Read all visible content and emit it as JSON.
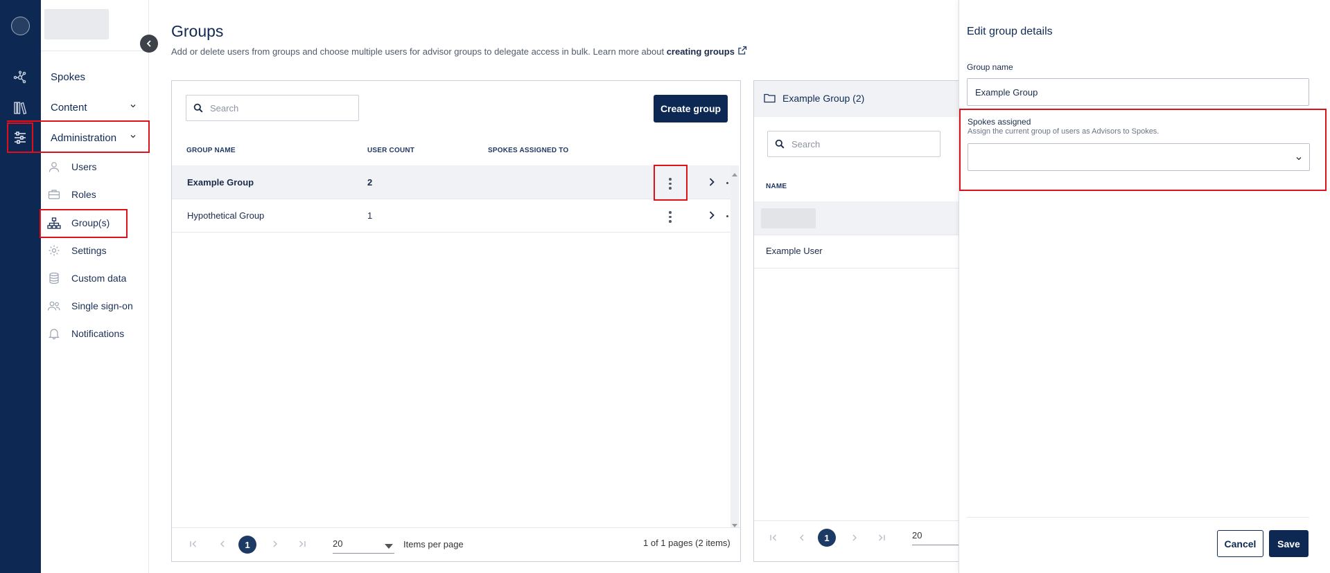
{
  "nav": {
    "spokes": "Spokes",
    "content": "Content",
    "administration": "Administration",
    "sub_items": [
      {
        "label": "Users"
      },
      {
        "label": "Roles"
      },
      {
        "label": "Group(s)"
      },
      {
        "label": "Settings"
      },
      {
        "label": "Custom data"
      },
      {
        "label": "Single sign-on"
      },
      {
        "label": "Notifications"
      }
    ]
  },
  "page": {
    "title": "Groups",
    "description": "Add or delete users from groups and choose multiple users for advisor groups to delegate access in bulk. Learn more about ",
    "link_text": "creating groups"
  },
  "groups_panel": {
    "search_placeholder": "Search",
    "create_button": "Create group",
    "columns": [
      "GROUP NAME",
      "USER COUNT",
      "SPOKES ASSIGNED TO"
    ],
    "rows": [
      {
        "name": "Example Group",
        "count": "2",
        "spokes": ""
      },
      {
        "name": "Hypothetical Group",
        "count": "1",
        "spokes": ""
      }
    ],
    "pager": {
      "current_page": "1",
      "items_per_page": "20",
      "items_per_page_label": "Items per page",
      "summary": "1 of 1 pages (2 items)"
    }
  },
  "members_panel": {
    "title": "Example Group (2)",
    "search_placeholder": "Search",
    "column": "NAME",
    "rows": [
      {
        "name": "Example User"
      }
    ],
    "pager": {
      "current_page": "1",
      "items_per_page": "20"
    }
  },
  "drawer": {
    "title": "Edit group details",
    "group_name_label": "Group name",
    "group_name_value": "Example Group",
    "spokes_label": "Spokes assigned",
    "spokes_help": "Assign the current group of users as Advisors to Spokes.",
    "spokes_value": "",
    "cancel": "Cancel",
    "save": "Save"
  },
  "colors": {
    "rail": "#0d2852",
    "primary": "#0d2852",
    "highlight": "#e0101b"
  }
}
